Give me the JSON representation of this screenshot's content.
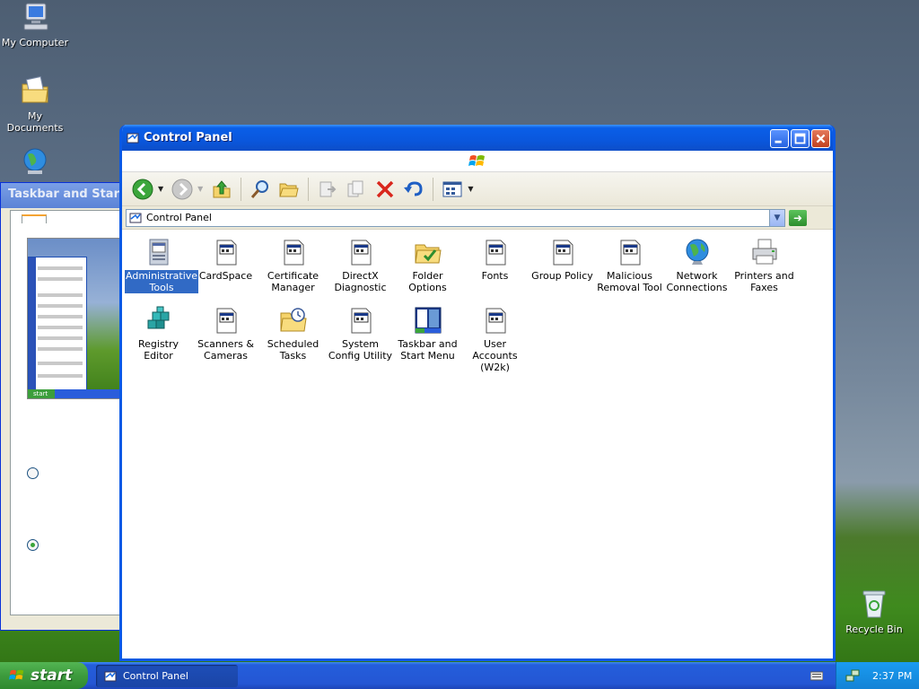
{
  "desktop": {
    "icons": [
      {
        "label": "My Computer"
      },
      {
        "label": "My Documents"
      },
      {
        "label": ""
      },
      {
        "label": "Recycle Bin"
      }
    ]
  },
  "background_window": {
    "title": "Taskbar and Start M",
    "preview_start_label": "start"
  },
  "window": {
    "title": "Control Panel",
    "address": "Control Panel"
  },
  "items": [
    {
      "label": "Administrative Tools",
      "icon": "admin-tools-icon",
      "selected": true
    },
    {
      "label": "CardSpace",
      "icon": "window-icon"
    },
    {
      "label": "Certificate Manager",
      "icon": "window-icon"
    },
    {
      "label": "DirectX Diagnostic",
      "icon": "window-icon"
    },
    {
      "label": "Folder Options",
      "icon": "folder-options-icon"
    },
    {
      "label": "Fonts",
      "icon": "window-icon"
    },
    {
      "label": "Group Policy",
      "icon": "window-icon"
    },
    {
      "label": "Malicious Removal Tool",
      "icon": "window-icon"
    },
    {
      "label": "Network Connections",
      "icon": "network-globe-icon"
    },
    {
      "label": "Printers and Faxes",
      "icon": "printer-icon"
    },
    {
      "label": "Registry Editor",
      "icon": "registry-cubes-icon"
    },
    {
      "label": "Scanners & Cameras",
      "icon": "window-icon"
    },
    {
      "label": "Scheduled Tasks",
      "icon": "scheduled-tasks-icon"
    },
    {
      "label": "System Config Utility",
      "icon": "window-icon"
    },
    {
      "label": "Taskbar and Start Menu",
      "icon": "taskbar-icon"
    },
    {
      "label": "User Accounts (W2k)",
      "icon": "window-icon"
    }
  ],
  "taskbar": {
    "start_label": "start",
    "active_task": "Control Panel",
    "clock": "2:37 PM"
  }
}
